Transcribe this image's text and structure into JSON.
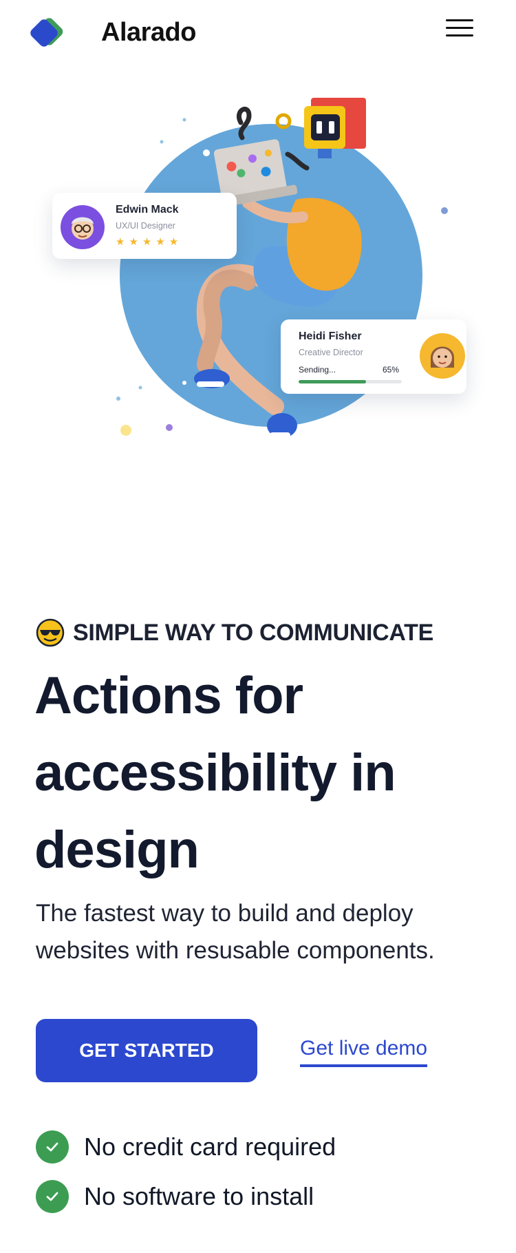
{
  "header": {
    "brand": "Alarado",
    "logo_colors": [
      "#2b4acb",
      "#3f9b5a"
    ],
    "menu_icon": "hamburger-icon"
  },
  "hero": {
    "card_designer": {
      "name": "Edwin Mack",
      "role": "UX/UI Designer",
      "rating_stars": 5,
      "stars_text": "★★★★★"
    },
    "card_director": {
      "name": "Heidi Fisher",
      "role": "Creative Director",
      "status_label": "Sending...",
      "progress_text": "65%",
      "progress": 0.65
    },
    "circle_color": "#64a6d9"
  },
  "content": {
    "eyebrow": "SIMPLE WAY TO COMMUNICATE",
    "eyebrow_icon": "sunglasses-emoji-icon",
    "headline": "Actions for accessibility in design",
    "lead": "The fastest way to build and deploy websites with resusable components.",
    "cta_primary": "GET STARTED",
    "cta_secondary": "Get live demo",
    "checks": [
      {
        "icon": "check-icon",
        "label": "No credit card required"
      },
      {
        "icon": "check-icon",
        "label": "No software to install"
      }
    ]
  },
  "colors": {
    "primary": "#2c48cf",
    "success": "#3c9d52",
    "heading": "#131a2e"
  }
}
